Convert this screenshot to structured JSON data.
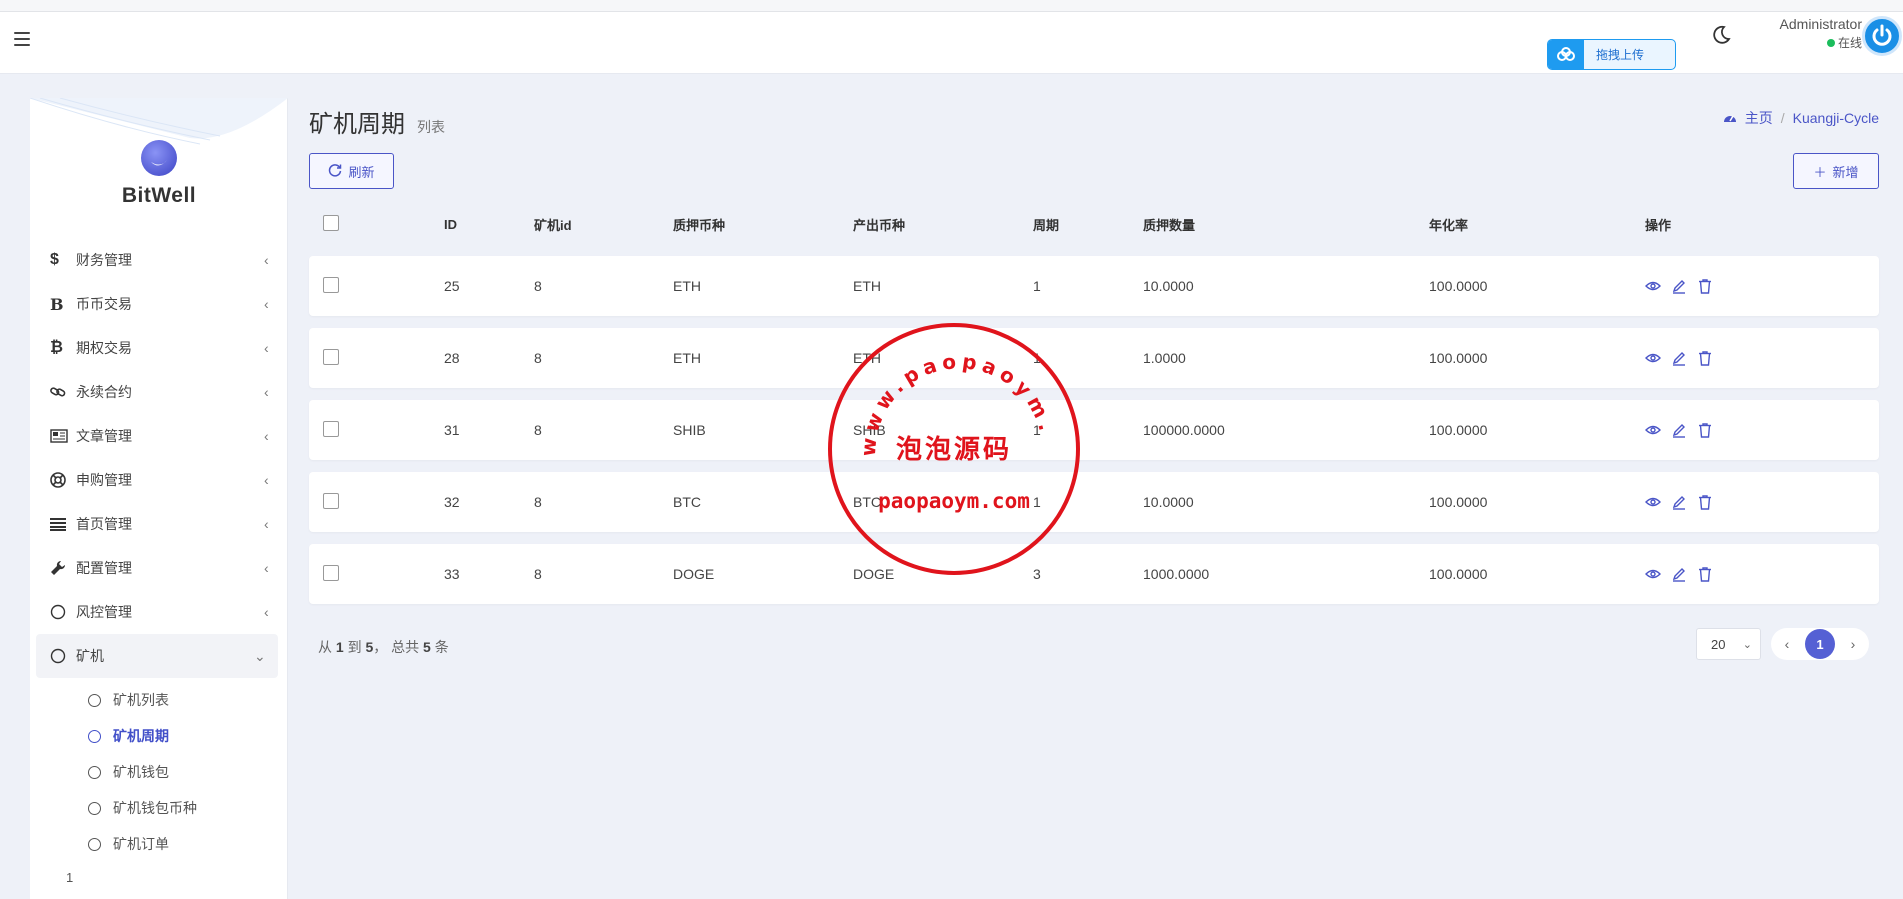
{
  "header": {
    "upload_label": "拖拽上传",
    "user_name": "Administrator",
    "user_status": "在线"
  },
  "sidebar": {
    "brand": "BitWell",
    "items": [
      {
        "label": "财务管理",
        "icon": "dollar-icon"
      },
      {
        "label": "币币交易",
        "icon": "b-letter-icon"
      },
      {
        "label": "期权交易",
        "icon": "bitcoin-icon"
      },
      {
        "label": "永续合约",
        "icon": "link-icon"
      },
      {
        "label": "文章管理",
        "icon": "newspaper-icon"
      },
      {
        "label": "申购管理",
        "icon": "lifebuoy-icon"
      },
      {
        "label": "首页管理",
        "icon": "list-icon"
      },
      {
        "label": "配置管理",
        "icon": "wrench-icon"
      },
      {
        "label": "风控管理",
        "icon": "circle-icon"
      },
      {
        "label": "矿机",
        "icon": "circle-icon"
      }
    ],
    "submenu": [
      {
        "label": "矿机列表",
        "active": false
      },
      {
        "label": "矿机周期",
        "active": true
      },
      {
        "label": "矿机钱包",
        "active": false
      },
      {
        "label": "矿机钱包币种",
        "active": false
      },
      {
        "label": "矿机订单",
        "active": false
      }
    ],
    "footer": "1"
  },
  "page": {
    "title": "矿机周期",
    "subtitle": "列表",
    "breadcrumb_home": "主页",
    "breadcrumb_sep": "/",
    "breadcrumb_current": "Kuangji-Cycle",
    "refresh_label": "刷新",
    "add_label": "新增"
  },
  "table": {
    "columns": [
      "ID",
      "矿机id",
      "质押币种",
      "产出币种",
      "周期",
      "质押数量",
      "年化率",
      "操作"
    ],
    "rows": [
      {
        "id": "25",
        "kid": "8",
        "pledge": "ETH",
        "output": "ETH",
        "period": "1",
        "qty": "10.0000",
        "apr": "100.0000"
      },
      {
        "id": "28",
        "kid": "8",
        "pledge": "ETH",
        "output": "ETH",
        "period": "1",
        "qty": "1.0000",
        "apr": "100.0000"
      },
      {
        "id": "31",
        "kid": "8",
        "pledge": "SHIB",
        "output": "SHIB",
        "period": "1",
        "qty": "100000.0000",
        "apr": "100.0000"
      },
      {
        "id": "32",
        "kid": "8",
        "pledge": "BTC",
        "output": "BTC",
        "period": "1",
        "qty": "10.0000",
        "apr": "100.0000"
      },
      {
        "id": "33",
        "kid": "8",
        "pledge": "DOGE",
        "output": "DOGE",
        "period": "3",
        "qty": "1000.0000",
        "apr": "100.0000"
      }
    ]
  },
  "pager": {
    "prefix": "从",
    "from": "1",
    "to_word": "到",
    "to": "5",
    "total_word": "， 总共",
    "total": "5",
    "suffix": "条",
    "page_size": "20",
    "current_page": "1"
  },
  "watermark": {
    "arc_text": "www.paopaoym.com",
    "center_text": "泡泡源码",
    "bottom_text": "paopaoym.com"
  },
  "colors": {
    "accent": "#4a55c7",
    "status_online": "#1bbd5c",
    "stamp_red": "#e0141c"
  }
}
